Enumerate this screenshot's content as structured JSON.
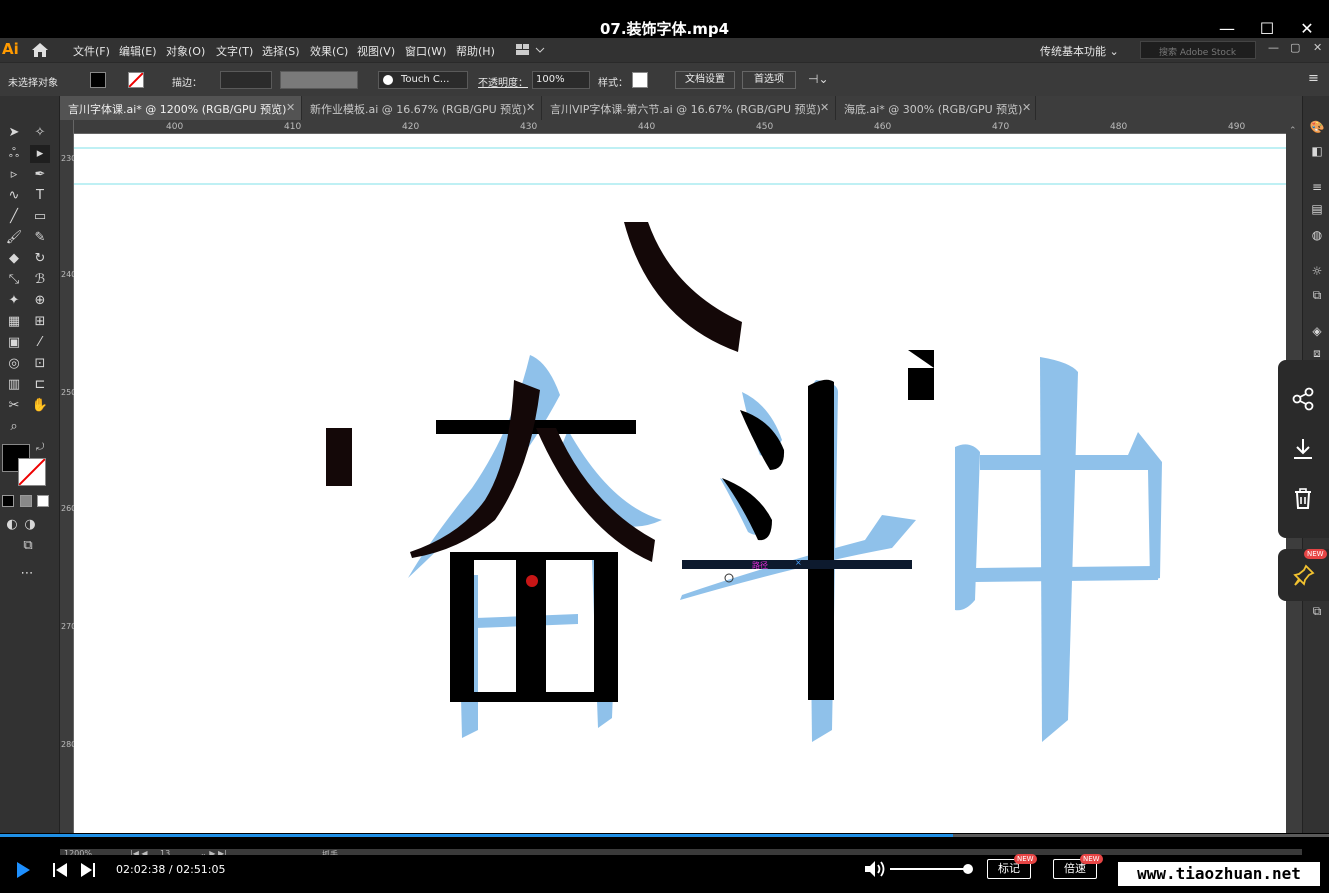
{
  "player": {
    "title": "07.装饰字体.mp4",
    "time_current": "02:02:38",
    "time_total": "02:51:05",
    "progress": 0.717,
    "volume": 1.0,
    "mark_label": "标记",
    "speed_label": "倍速",
    "new_badge": "NEW",
    "watermark": "www.tiaozhuan.net"
  },
  "illustrator": {
    "logo": "Ai",
    "menu": [
      "文件(F)",
      "编辑(E)",
      "对象(O)",
      "文字(T)",
      "选择(S)",
      "效果(C)",
      "视图(V)",
      "窗口(W)",
      "帮助(H)"
    ],
    "workspace": "传统基本功能",
    "search_placeholder": "搜索 Adobe Stock"
  },
  "control_bar": {
    "selection": "未选择对象",
    "stroke_label": "描边：",
    "brush": "Touch C...",
    "opacity_label": "不透明度：",
    "opacity_value": "100%",
    "style_label": "样式：",
    "doc_setup": "文档设置",
    "preferences": "首选项"
  },
  "tabs": [
    {
      "label": "言川字体课.ai* @ 1200% (RGB/GPU 预览)",
      "active": true
    },
    {
      "label": "新作业模板.ai @ 16.67% (RGB/GPU 预览)",
      "active": false
    },
    {
      "label": "言川VIP字体课-第六节.ai @ 16.67% (RGB/GPU 预览)",
      "active": false
    },
    {
      "label": "海底.ai* @ 300% (RGB/GPU 预览)",
      "active": false
    }
  ],
  "ruler": {
    "h": [
      "400",
      "410",
      "420",
      "430",
      "440",
      "450",
      "460",
      "470",
      "480",
      "490"
    ],
    "v": [
      "230",
      "240",
      "250",
      "260",
      "270",
      "280"
    ]
  },
  "canvas": {
    "path_label": "路径",
    "reference_color": "#8fc1ea",
    "stroke_color": "#000000"
  },
  "status": {
    "zoom": "1200%",
    "artboard": "13",
    "tool": "抓手"
  }
}
